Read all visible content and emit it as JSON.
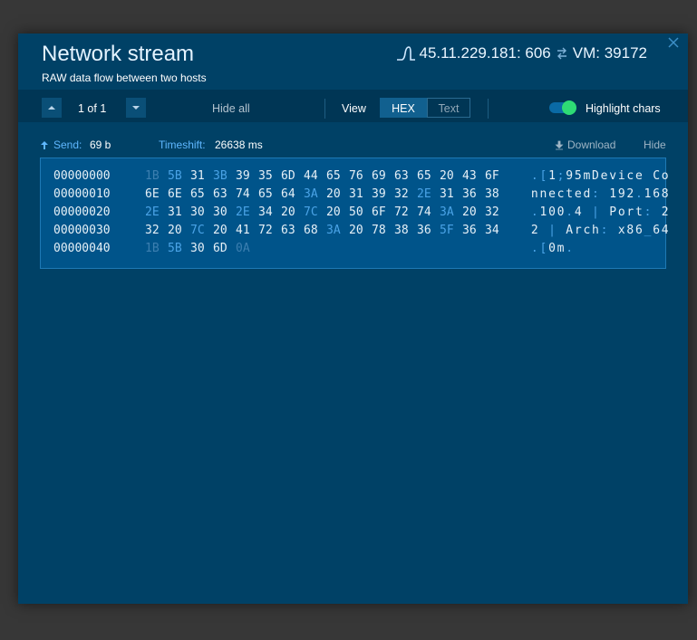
{
  "header": {
    "title": "Network stream",
    "subtitle": "RAW data flow between two hosts",
    "source": "45.11.229.181: 606",
    "target": "VM: 39172"
  },
  "toolbar": {
    "pager": "1 of 1",
    "hide_all": "Hide all",
    "view_label": "View",
    "view_options": [
      "HEX",
      "Text"
    ],
    "view_selected": "HEX",
    "highlight_label": "Highlight chars",
    "highlight_on": true
  },
  "info": {
    "send_label": "Send:",
    "send_value": "69 b",
    "timeshift_label": "Timeshift:",
    "timeshift_value": "26638 ms",
    "download_label": "Download",
    "hide_label": "Hide"
  },
  "hex": {
    "rows": [
      {
        "addr": "00000000",
        "bytes": [
          {
            "v": "1B",
            "k": "d"
          },
          {
            "v": "5B",
            "k": "c"
          },
          {
            "v": "31",
            "k": ""
          },
          {
            "v": "3B",
            "k": "c"
          },
          {
            "v": "39",
            "k": ""
          },
          {
            "v": "35",
            "k": ""
          },
          {
            "v": "6D",
            "k": ""
          },
          {
            "v": "44",
            "k": ""
          },
          {
            "v": "65",
            "k": ""
          },
          {
            "v": "76",
            "k": ""
          },
          {
            "v": "69",
            "k": ""
          },
          {
            "v": "63",
            "k": ""
          },
          {
            "v": "65",
            "k": ""
          },
          {
            "v": "20",
            "k": ""
          },
          {
            "v": "43",
            "k": ""
          },
          {
            "v": "6F",
            "k": ""
          }
        ],
        "ascii": [
          {
            "v": ".",
            "k": "c"
          },
          {
            "v": "[",
            "k": "c"
          },
          {
            "v": "1",
            "k": ""
          },
          {
            "v": ";",
            "k": "c"
          },
          {
            "v": "9",
            "k": ""
          },
          {
            "v": "5",
            "k": ""
          },
          {
            "v": "m",
            "k": ""
          },
          {
            "v": "D",
            "k": ""
          },
          {
            "v": "e",
            "k": ""
          },
          {
            "v": "v",
            "k": ""
          },
          {
            "v": "i",
            "k": ""
          },
          {
            "v": "c",
            "k": ""
          },
          {
            "v": "e",
            "k": ""
          },
          {
            "v": " ",
            "k": ""
          },
          {
            "v": "C",
            "k": ""
          },
          {
            "v": "o",
            "k": ""
          }
        ]
      },
      {
        "addr": "00000010",
        "bytes": [
          {
            "v": "6E",
            "k": ""
          },
          {
            "v": "6E",
            "k": ""
          },
          {
            "v": "65",
            "k": ""
          },
          {
            "v": "63",
            "k": ""
          },
          {
            "v": "74",
            "k": ""
          },
          {
            "v": "65",
            "k": ""
          },
          {
            "v": "64",
            "k": ""
          },
          {
            "v": "3A",
            "k": "c"
          },
          {
            "v": "20",
            "k": ""
          },
          {
            "v": "31",
            "k": ""
          },
          {
            "v": "39",
            "k": ""
          },
          {
            "v": "32",
            "k": ""
          },
          {
            "v": "2E",
            "k": "c"
          },
          {
            "v": "31",
            "k": ""
          },
          {
            "v": "36",
            "k": ""
          },
          {
            "v": "38",
            "k": ""
          }
        ],
        "ascii": [
          {
            "v": "n",
            "k": ""
          },
          {
            "v": "n",
            "k": ""
          },
          {
            "v": "e",
            "k": ""
          },
          {
            "v": "c",
            "k": ""
          },
          {
            "v": "t",
            "k": ""
          },
          {
            "v": "e",
            "k": ""
          },
          {
            "v": "d",
            "k": ""
          },
          {
            "v": ":",
            "k": "c"
          },
          {
            "v": " ",
            "k": ""
          },
          {
            "v": "1",
            "k": ""
          },
          {
            "v": "9",
            "k": ""
          },
          {
            "v": "2",
            "k": ""
          },
          {
            "v": ".",
            "k": "c"
          },
          {
            "v": "1",
            "k": ""
          },
          {
            "v": "6",
            "k": ""
          },
          {
            "v": "8",
            "k": ""
          }
        ]
      },
      {
        "addr": "00000020",
        "bytes": [
          {
            "v": "2E",
            "k": "c"
          },
          {
            "v": "31",
            "k": ""
          },
          {
            "v": "30",
            "k": ""
          },
          {
            "v": "30",
            "k": ""
          },
          {
            "v": "2E",
            "k": "c"
          },
          {
            "v": "34",
            "k": ""
          },
          {
            "v": "20",
            "k": ""
          },
          {
            "v": "7C",
            "k": "c"
          },
          {
            "v": "20",
            "k": ""
          },
          {
            "v": "50",
            "k": ""
          },
          {
            "v": "6F",
            "k": ""
          },
          {
            "v": "72",
            "k": ""
          },
          {
            "v": "74",
            "k": ""
          },
          {
            "v": "3A",
            "k": "c"
          },
          {
            "v": "20",
            "k": ""
          },
          {
            "v": "32",
            "k": ""
          }
        ],
        "ascii": [
          {
            "v": ".",
            "k": "c"
          },
          {
            "v": "1",
            "k": ""
          },
          {
            "v": "0",
            "k": ""
          },
          {
            "v": "0",
            "k": ""
          },
          {
            "v": ".",
            "k": "c"
          },
          {
            "v": "4",
            "k": ""
          },
          {
            "v": " ",
            "k": ""
          },
          {
            "v": "|",
            "k": "c"
          },
          {
            "v": " ",
            "k": ""
          },
          {
            "v": "P",
            "k": ""
          },
          {
            "v": "o",
            "k": ""
          },
          {
            "v": "r",
            "k": ""
          },
          {
            "v": "t",
            "k": ""
          },
          {
            "v": ":",
            "k": "c"
          },
          {
            "v": " ",
            "k": ""
          },
          {
            "v": "2",
            "k": ""
          }
        ]
      },
      {
        "addr": "00000030",
        "bytes": [
          {
            "v": "32",
            "k": ""
          },
          {
            "v": "20",
            "k": ""
          },
          {
            "v": "7C",
            "k": "c"
          },
          {
            "v": "20",
            "k": ""
          },
          {
            "v": "41",
            "k": ""
          },
          {
            "v": "72",
            "k": ""
          },
          {
            "v": "63",
            "k": ""
          },
          {
            "v": "68",
            "k": ""
          },
          {
            "v": "3A",
            "k": "c"
          },
          {
            "v": "20",
            "k": ""
          },
          {
            "v": "78",
            "k": ""
          },
          {
            "v": "38",
            "k": ""
          },
          {
            "v": "36",
            "k": ""
          },
          {
            "v": "5F",
            "k": "c"
          },
          {
            "v": "36",
            "k": ""
          },
          {
            "v": "34",
            "k": ""
          }
        ],
        "ascii": [
          {
            "v": "2",
            "k": ""
          },
          {
            "v": " ",
            "k": ""
          },
          {
            "v": "|",
            "k": "c"
          },
          {
            "v": " ",
            "k": ""
          },
          {
            "v": "A",
            "k": ""
          },
          {
            "v": "r",
            "k": ""
          },
          {
            "v": "c",
            "k": ""
          },
          {
            "v": "h",
            "k": ""
          },
          {
            "v": ":",
            "k": "c"
          },
          {
            "v": " ",
            "k": ""
          },
          {
            "v": "x",
            "k": ""
          },
          {
            "v": "8",
            "k": ""
          },
          {
            "v": "6",
            "k": ""
          },
          {
            "v": "_",
            "k": "c"
          },
          {
            "v": "6",
            "k": ""
          },
          {
            "v": "4",
            "k": ""
          }
        ]
      },
      {
        "addr": "00000040",
        "bytes": [
          {
            "v": "1B",
            "k": "d"
          },
          {
            "v": "5B",
            "k": "c"
          },
          {
            "v": "30",
            "k": ""
          },
          {
            "v": "6D",
            "k": ""
          },
          {
            "v": "0A",
            "k": "d"
          }
        ],
        "ascii": [
          {
            "v": ".",
            "k": "c"
          },
          {
            "v": "[",
            "k": "c"
          },
          {
            "v": "0",
            "k": ""
          },
          {
            "v": "m",
            "k": ""
          },
          {
            "v": ".",
            "k": "c"
          }
        ]
      }
    ]
  },
  "colors": {
    "panel": "#004166",
    "toolbar": "#003655",
    "hexbox": "#00548a",
    "accent": "#5fb7ff",
    "control_char": "#4aa3e6",
    "toggle_on": "#2edb75"
  },
  "icons": {
    "signal": "signal-wave-icon",
    "swap": "swap-arrows-icon",
    "close": "close-icon",
    "prev": "chevron-up-icon",
    "next": "chevron-down-icon",
    "send": "arrow-up-icon",
    "download": "download-icon"
  }
}
